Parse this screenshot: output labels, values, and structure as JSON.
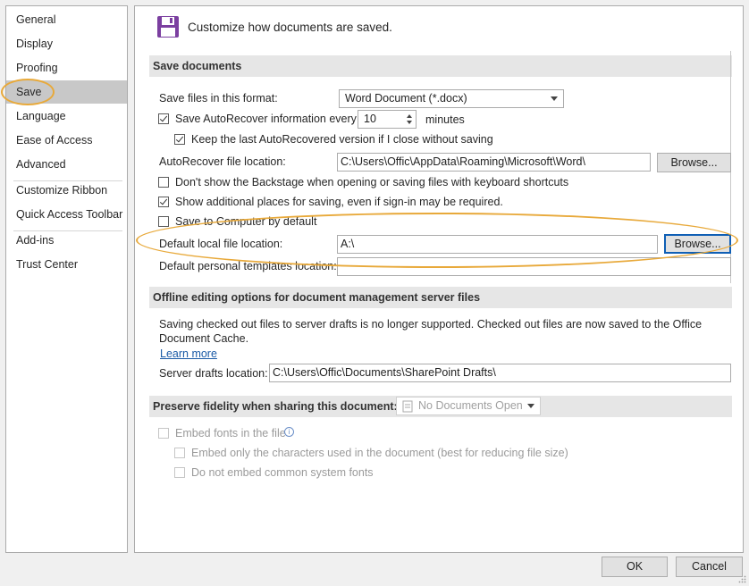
{
  "sidebar": {
    "items": [
      {
        "label": "General"
      },
      {
        "label": "Display"
      },
      {
        "label": "Proofing"
      },
      {
        "label": "Save"
      },
      {
        "label": "Language"
      },
      {
        "label": "Ease of Access"
      },
      {
        "label": "Advanced"
      },
      {
        "label": "Customize Ribbon"
      },
      {
        "label": "Quick Access Toolbar"
      },
      {
        "label": "Add-ins"
      },
      {
        "label": "Trust Center"
      }
    ],
    "active": "Save"
  },
  "header": {
    "icon": "floppy-disk-icon",
    "title": "Customize how documents are saved."
  },
  "save_documents": {
    "heading": "Save documents",
    "format_label": "Save files in this format:",
    "format_value": "Word Document (*.docx)",
    "autorecover_label": "Save AutoRecover information every",
    "autorecover_checked": true,
    "autorecover_minutes": "10",
    "minutes_label": "minutes",
    "keep_last_label": "Keep the last AutoRecovered version if I close without saving",
    "keep_last_checked": true,
    "autorecover_location_label": "AutoRecover file location:",
    "autorecover_location_value": "C:\\Users\\Offic\\AppData\\Roaming\\Microsoft\\Word\\",
    "browse_label": "Browse...",
    "backstage_label": "Don't show the Backstage when opening or saving files with keyboard shortcuts",
    "backstage_checked": false,
    "additional_places_label": "Show additional places for saving, even if sign-in may be required.",
    "additional_places_checked": true,
    "save_to_computer_label": "Save to Computer by default",
    "save_to_computer_checked": false,
    "default_local_label": "Default local file location:",
    "default_local_value": "A:\\",
    "browse_label_2": "Browse...",
    "personal_templates_label": "Default personal templates location:",
    "personal_templates_value": ""
  },
  "offline": {
    "heading": "Offline editing options for document management server files",
    "notice": "Saving checked out files to server drafts is no longer supported. Checked out files are now saved to the Office Document Cache.",
    "learn_more": "Learn more",
    "server_drafts_label": "Server drafts location:",
    "server_drafts_value": "C:\\Users\\Offic\\Documents\\SharePoint Drafts\\"
  },
  "fidelity": {
    "heading": "Preserve fidelity when sharing this document:",
    "doc_select": "No Documents Open",
    "embed_fonts_label": "Embed fonts in the file",
    "embed_used_label": "Embed only the characters used in the document (best for reducing file size)",
    "no_common_label": "Do not embed common system fonts"
  },
  "footer": {
    "ok": "OK",
    "cancel": "Cancel"
  },
  "colors": {
    "highlight_oval": "#e8a93a",
    "active_nav": "#c8c8c8",
    "link": "#1a5aa6",
    "floppy_icon": "#7b3fa0"
  }
}
